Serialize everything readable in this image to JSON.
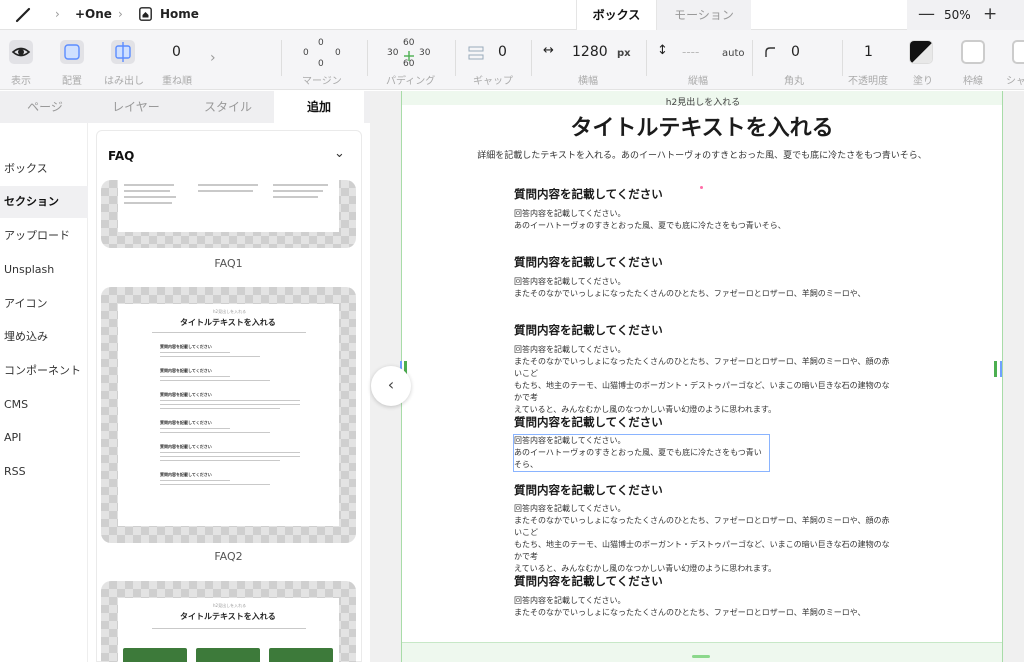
{
  "topbar": {
    "project": "+One",
    "page": "Home",
    "mode_tabs": [
      "ボックス",
      "モーション"
    ],
    "zoom": "50%",
    "zoom_minus": "—",
    "zoom_plus": "+"
  },
  "props": {
    "display_label": "表示",
    "align_label": "配置",
    "overflow_label": "はみ出し",
    "zindex_value": "0",
    "zindex_label": "重ね順",
    "margin": {
      "top": "0",
      "left": "0",
      "right": "0",
      "bottom": "0",
      "label": "マージン"
    },
    "padding": {
      "top": "60",
      "left": "30",
      "right": "30",
      "bottom": "60",
      "label": "パディング"
    },
    "gap": {
      "value": "0",
      "label": "ギャップ"
    },
    "width": {
      "value": "1280",
      "unit": "px",
      "label": "横幅"
    },
    "height": {
      "value": "----",
      "unit": "auto",
      "label": "縦幅"
    },
    "radius": {
      "value": "0",
      "label": "角丸"
    },
    "opacity": {
      "value": "1",
      "label": "不透明度"
    },
    "fill_label": "塗り",
    "border_label": "枠線",
    "shadow_label": "シャ"
  },
  "panel_tabs": [
    "ページ",
    "レイヤー",
    "スタイル",
    "追加"
  ],
  "categories": [
    "ボックス",
    "セクション",
    "アップロード",
    "Unsplash",
    "アイコン",
    "埋め込み",
    "コンポーネント",
    "CMS",
    "API",
    "RSS"
  ],
  "faq": {
    "header": "FAQ",
    "items": [
      "FAQ1",
      "FAQ2"
    ],
    "thumb_heading_label": "h2見出しを入れる",
    "thumb_title": "タイトルテキストを入れる",
    "thumb_question": "質問内容を記載してください"
  },
  "canvas": {
    "heading_label": "h2見出しを入れる",
    "title": "タイトルテキストを入れる",
    "description": "詳細を記載したテキストを入れる。あのイーハトーヴォのすきとおった風、夏でも底に冷たさをもつ青いそら、",
    "faqs": [
      {
        "q": "質問内容を記載してください",
        "a": "回答内容を記載してください。\nあのイーハトーヴォのすきとおった風、夏でも底に冷たさをもつ青いそら、"
      },
      {
        "q": "質問内容を記載してください",
        "a": "回答内容を記載してください。\nまたそのなかでいっしょになったたくさんのひとたち、ファゼーロとロザーロ、羊飼のミーロや、"
      },
      {
        "q": "質問内容を記載してください",
        "a": "回答内容を記載してください。\nまたそのなかでいっしょになったたくさんのひとたち、ファゼーロとロザーロ、羊飼のミーロや、顔の赤いこど\nもたち、地主のテーモ、山猫博士のボーガント・デストゥパーゴなど、いまこの暗い巨きな石の建物のなかで考\nえていると、みんなむかし風のなつかしい青い幻燈のように思われます。"
      },
      {
        "q": "質問内容を記載してください",
        "a": "回答内容を記載してください。\nあのイーハトーヴォのすきとおった風、夏でも底に冷たさをもつ青いそら、"
      },
      {
        "q": "質問内容を記載してください",
        "a": "回答内容を記載してください。\nまたそのなかでいっしょになったたくさんのひとたち、ファゼーロとロザーロ、羊飼のミーロや、顔の赤いこど\nもたち、地主のテーモ、山猫博士のボーガント・デストゥパーゴなど、いまこの暗い巨きな石の建物のなかで考\nえていると、みんなむかし風のなつかしい青い幻燈のように思われます。"
      },
      {
        "q": "質問内容を記載してください",
        "a": "回答内容を記載してください。\nまたそのなかでいっしょになったたくさんのひとたち、ファゼーロとロザーロ、羊飼のミーロや、"
      }
    ]
  },
  "colors": {
    "accent": "#4caf50",
    "selection": "#8ab4ff",
    "toolbar_bg": "#f5f5f7"
  }
}
